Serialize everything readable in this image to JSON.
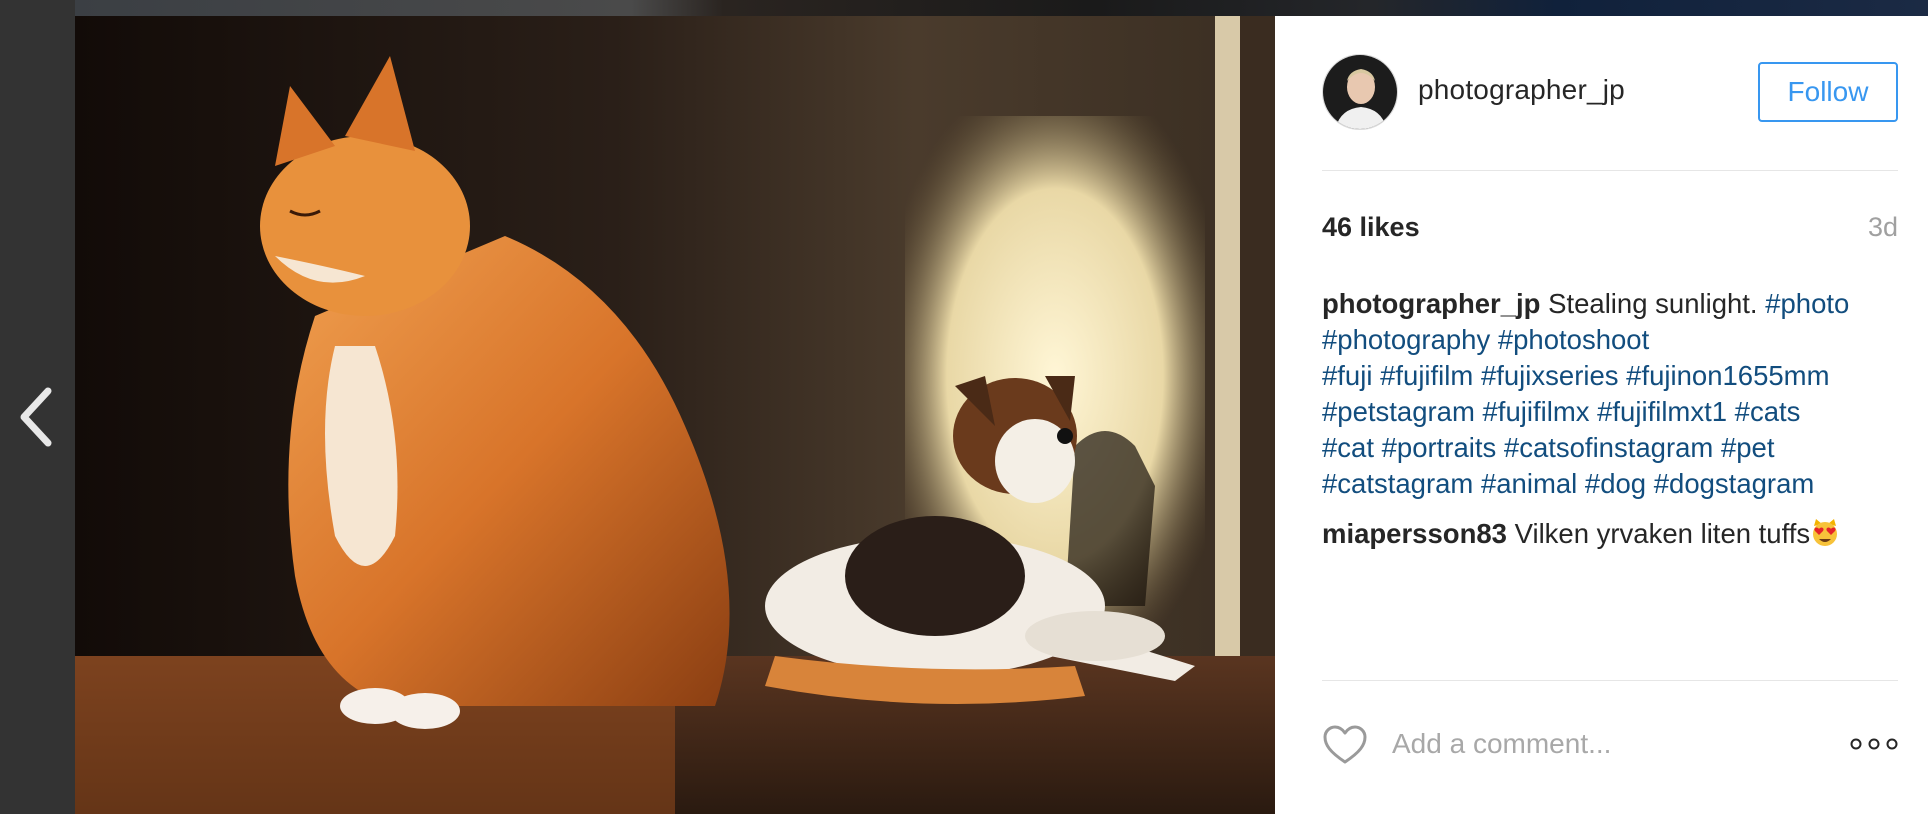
{
  "post": {
    "username": "photographer_jp",
    "follow_label": "Follow",
    "likes": "46 likes",
    "time_ago": "3d"
  },
  "caption": {
    "author": "photographer_jp",
    "text": "Stealing sunlight.",
    "hashtags": [
      "#photo",
      "#photography",
      "#photoshoot",
      "#fuji",
      "#fujifilm",
      "#fujixseries",
      "#fujinon1655mm",
      "#petstagram",
      "#fujifilmx",
      "#fujifilmxt1",
      "#cats",
      "#cat",
      "#portraits",
      "#catsofinstagram",
      "#pet",
      "#catstagram",
      "#animal",
      "#dog",
      "#dogstagram"
    ]
  },
  "comments": [
    {
      "author": "miapersson83",
      "text": "Vilken yrvaken liten tuffs",
      "emoji": "heart-eyes-cat-emoji"
    }
  ],
  "composer": {
    "placeholder": "Add a comment..."
  },
  "icons": {
    "prev": "chevron-left-icon",
    "like": "heart-icon",
    "options": "more-options-icon"
  },
  "colors": {
    "follow_blue": "#3897f0",
    "hashtag": "#124d7e",
    "text": "#262626",
    "muted": "#a0a0a0"
  }
}
